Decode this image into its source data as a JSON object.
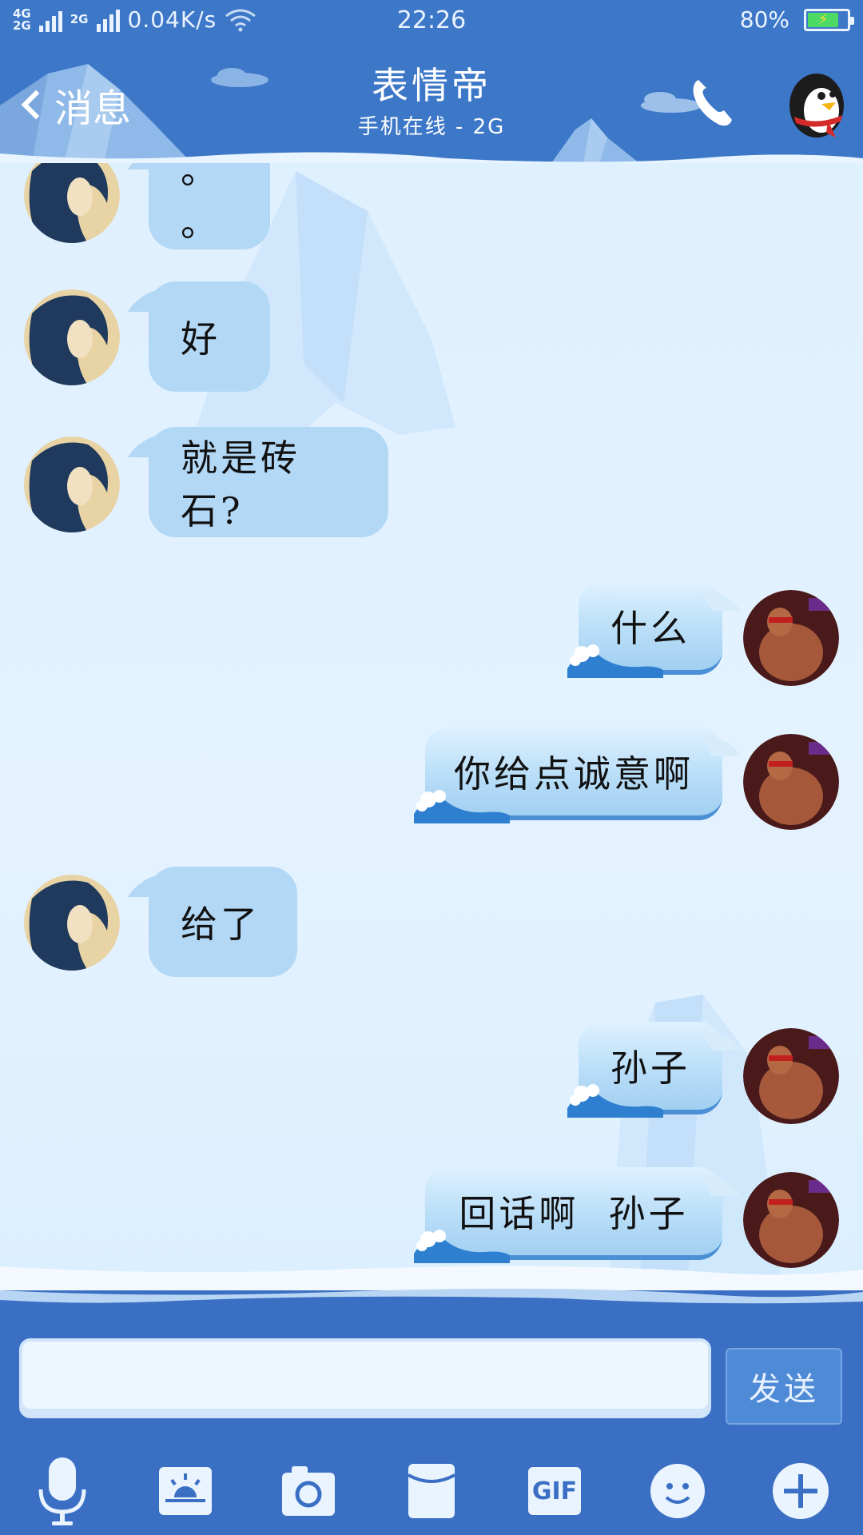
{
  "status_bar": {
    "network_top": "4G",
    "network_bottom": "2G",
    "network2": "2G",
    "speed": "0.04K/s",
    "time": "22:26",
    "battery_percent": "80%",
    "battery_level": 0.8
  },
  "header": {
    "back_label": "消息",
    "title": "表情帝",
    "subtitle": "手机在线 - 2G",
    "icons": [
      "chevron-left-icon",
      "phone-icon",
      "penguin-icon"
    ]
  },
  "messages": [
    {
      "side": "in",
      "text": "。 。"
    },
    {
      "side": "in",
      "text": "好"
    },
    {
      "side": "in",
      "text": "就是砖石?"
    },
    {
      "side": "out",
      "text": "什么"
    },
    {
      "side": "out",
      "text": "你给点诚意啊"
    },
    {
      "side": "in",
      "text": "给了"
    },
    {
      "side": "out",
      "text": "孙子"
    },
    {
      "side": "out",
      "text": "回话啊  孙子"
    }
  ],
  "input": {
    "value": "",
    "send_label": "发送"
  },
  "toolbar": {
    "gif_label": "GIF",
    "icons": [
      "microphone-icon",
      "photo-icon",
      "camera-icon",
      "red-packet-icon",
      "gif-icon",
      "emoji-icon",
      "plus-icon"
    ]
  },
  "colors": {
    "header_blue": "#3d78c8",
    "incoming_bubble": "#b3d8f6",
    "outgoing_bubble": "#bfe0f8",
    "battery_green": "#4cd964"
  }
}
